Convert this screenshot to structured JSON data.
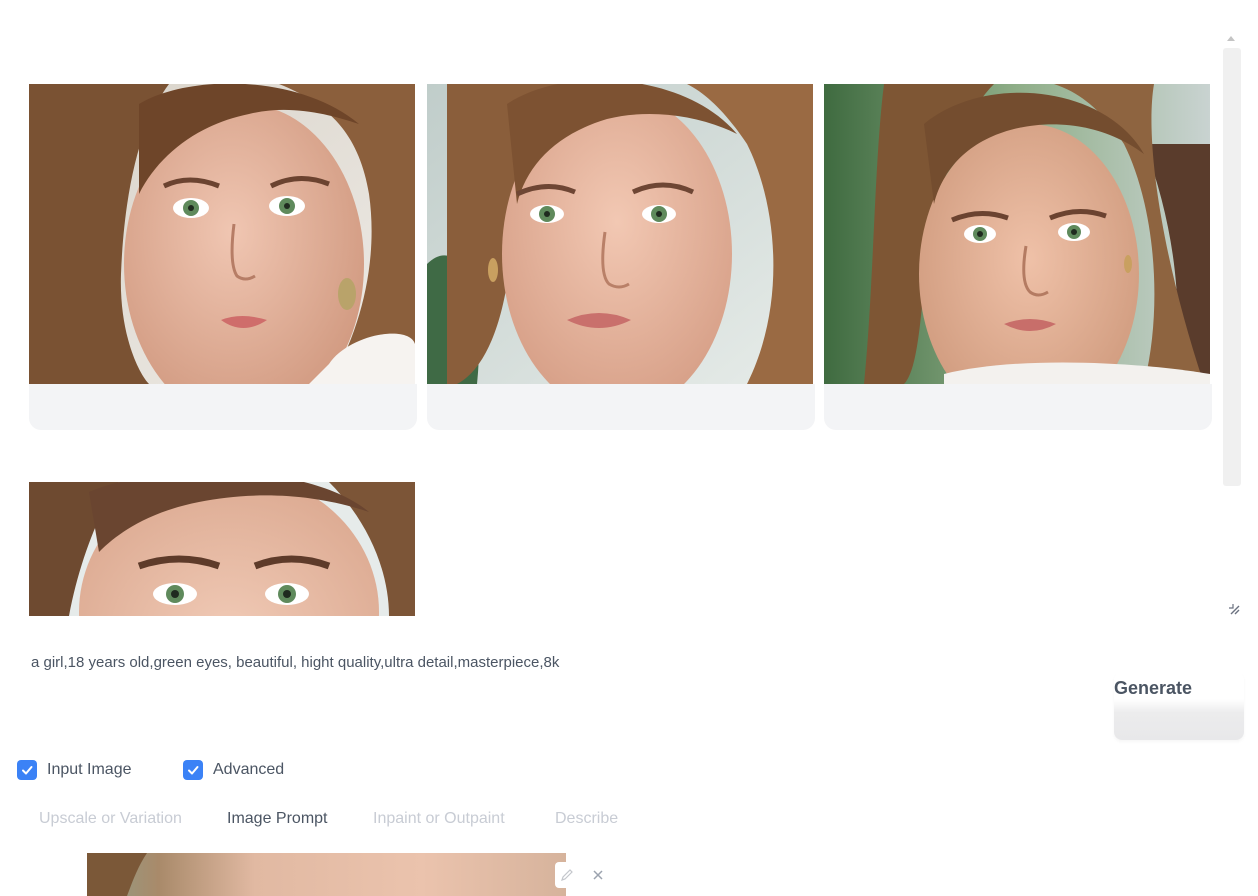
{
  "gallery": {
    "images": [
      {
        "name": "generated-image-1",
        "background": "#e4e1dc",
        "hair": "#7a5233",
        "skin": "#e3b29c"
      },
      {
        "name": "generated-image-2",
        "background": "#c9d5d1",
        "hair": "#8a5e3b",
        "skin": "#e6b9a2"
      },
      {
        "name": "generated-image-3",
        "background": "#4a7a48",
        "hair": "#7e5634",
        "skin": "#e2ae93"
      },
      {
        "name": "generated-image-4",
        "background": "#dfe4e2",
        "hair": "#6e4a30",
        "skin": "#e8bda6"
      }
    ]
  },
  "prompt": {
    "text": "a girl,18 years old,green eyes, beautiful, hight quality,ultra detail,masterpiece,8k"
  },
  "generate": {
    "label": "Generate"
  },
  "options": {
    "input_image": {
      "label": "Input Image",
      "checked": true
    },
    "advanced": {
      "label": "Advanced",
      "checked": true
    }
  },
  "tabs": [
    {
      "label": "Upscale or Variation",
      "active": false
    },
    {
      "label": "Image Prompt",
      "active": true
    },
    {
      "label": "Inpaint or Outpaint",
      "active": false
    },
    {
      "label": "Describe",
      "active": false
    }
  ],
  "colors": {
    "accent": "#3b82f6",
    "text": "#4b5563",
    "muted_tab": "#c8ccd4",
    "eye_green": "#5f8a5c"
  },
  "icons": {
    "edit": "pencil-icon",
    "clear": "close-icon",
    "resize": "resize-handle-icon",
    "check": "check-icon"
  }
}
